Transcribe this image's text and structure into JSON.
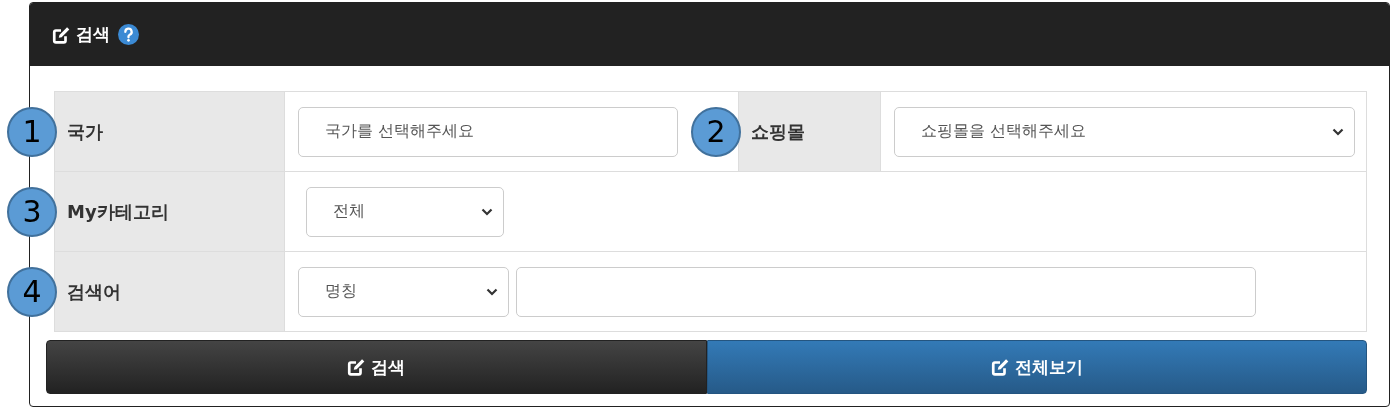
{
  "panel": {
    "title": "검색"
  },
  "rows": [
    {
      "cells": [
        {
          "callout": "1",
          "label": "국가",
          "controls": [
            {
              "kind": "combo",
              "value": "국가를 선택해주세요"
            }
          ]
        },
        {
          "callout": "2",
          "label": "쇼핑몰",
          "controls": [
            {
              "kind": "select",
              "value": "쇼핑몰을 선택해주세요"
            }
          ]
        }
      ]
    },
    {
      "cells": [
        {
          "callout": "3",
          "label": "My카테고리",
          "controls": [
            {
              "kind": "select",
              "value": "전체"
            }
          ]
        }
      ]
    },
    {
      "cells": [
        {
          "callout": "4",
          "label": "검색어",
          "controls": [
            {
              "kind": "select",
              "value": "명칭"
            },
            {
              "kind": "text"
            }
          ]
        }
      ]
    }
  ],
  "buttons": [
    {
      "label": "검색",
      "kind": "dark"
    },
    {
      "label": "전체보기",
      "kind": "primary"
    }
  ]
}
